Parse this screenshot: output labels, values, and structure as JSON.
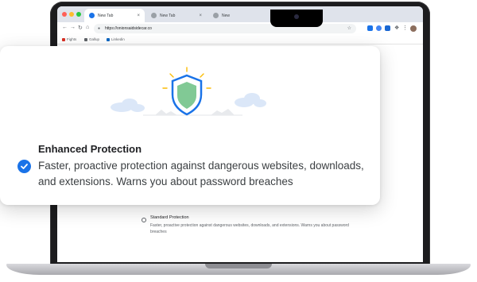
{
  "browser": {
    "tabs": [
      {
        "label": "New Tab"
      },
      {
        "label": "New Tab"
      },
      {
        "label": "New"
      }
    ],
    "new_tab_symbol": "+",
    "close_symbol": "×",
    "address_bar": {
      "url": "https://onionsaidsidecar.co"
    },
    "bookmarks": [
      "Fights",
      "Gallup",
      "Linkedin"
    ]
  },
  "card": {
    "title": "Enhanced Protection",
    "description": "Faster, proactive protection against dangerous websites, downloads, and extensions. Warns you about password breaches"
  },
  "standard": {
    "title": "Standard Protection",
    "description": "Faster, proactive protection against dangerous websites, downloads, and extensions. Warns you about password breaches"
  },
  "colors": {
    "accent": "#1a73e8",
    "shield_outer": "#1a73e8",
    "shield_inner": "#81c995",
    "sun_rays": "#fbbc04",
    "clouds": "#dbe7f8"
  },
  "icons": [
    "shield-icon",
    "check-icon",
    "lock-icon",
    "star-icon",
    "back-icon",
    "forward-icon",
    "reload-icon",
    "home-icon"
  ]
}
